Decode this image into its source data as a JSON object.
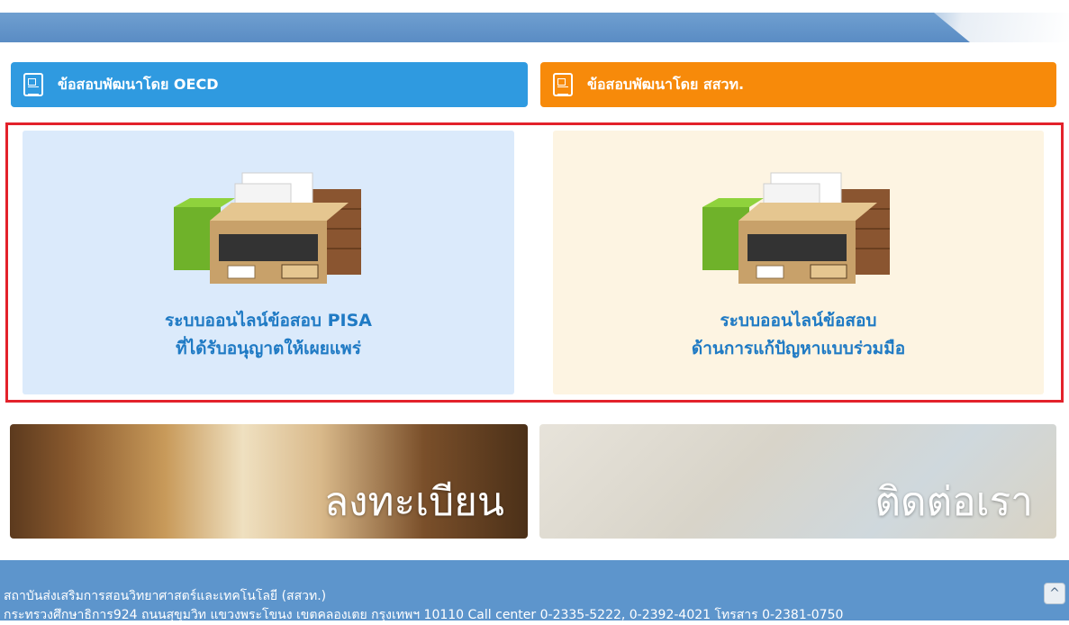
{
  "header_blue": {
    "label": "ข้อสอบพัฒนาโดย OECD",
    "icon": "document-icon"
  },
  "header_orange": {
    "label": "ข้อสอบพัฒนาโดย สสวท.",
    "icon": "document-icon"
  },
  "panel_pisa": {
    "line1": "ระบบออนไลน์ข้อสอบ PISA",
    "line2": "ที่ได้รับอนุญาตให้เผยแพร่",
    "icon": "archive-box-icon"
  },
  "panel_collab": {
    "line1": "ระบบออนไลน์ข้อสอบ",
    "line2": "ด้านการแก้ปัญหาแบบร่วมมือ",
    "icon": "archive-box-icon"
  },
  "register_tile": {
    "label": "ลงทะเบียน"
  },
  "contact_tile": {
    "label": "ติดต่อเรา"
  },
  "footer": {
    "org": "สถาบันส่งเสริมการสอนวิทยาศาสตร์และเทคโนโลยี (สสวท.)",
    "address": "กระทรวงศึกษาธิการ924 ถนนสุขุมวิท แขวงพระโขนง เขตคลองเตย กรุงเทพฯ 10110 Call center 0-2335-5222, 0-2392-4021 โทรสาร 0-2381-0750"
  },
  "scroll_top": {
    "glyph": "^"
  },
  "colors": {
    "blue_header": "#2f9ae0",
    "orange_header": "#f78a0a",
    "frame_red": "#e3222b",
    "title_blue": "#1f7ac4"
  }
}
